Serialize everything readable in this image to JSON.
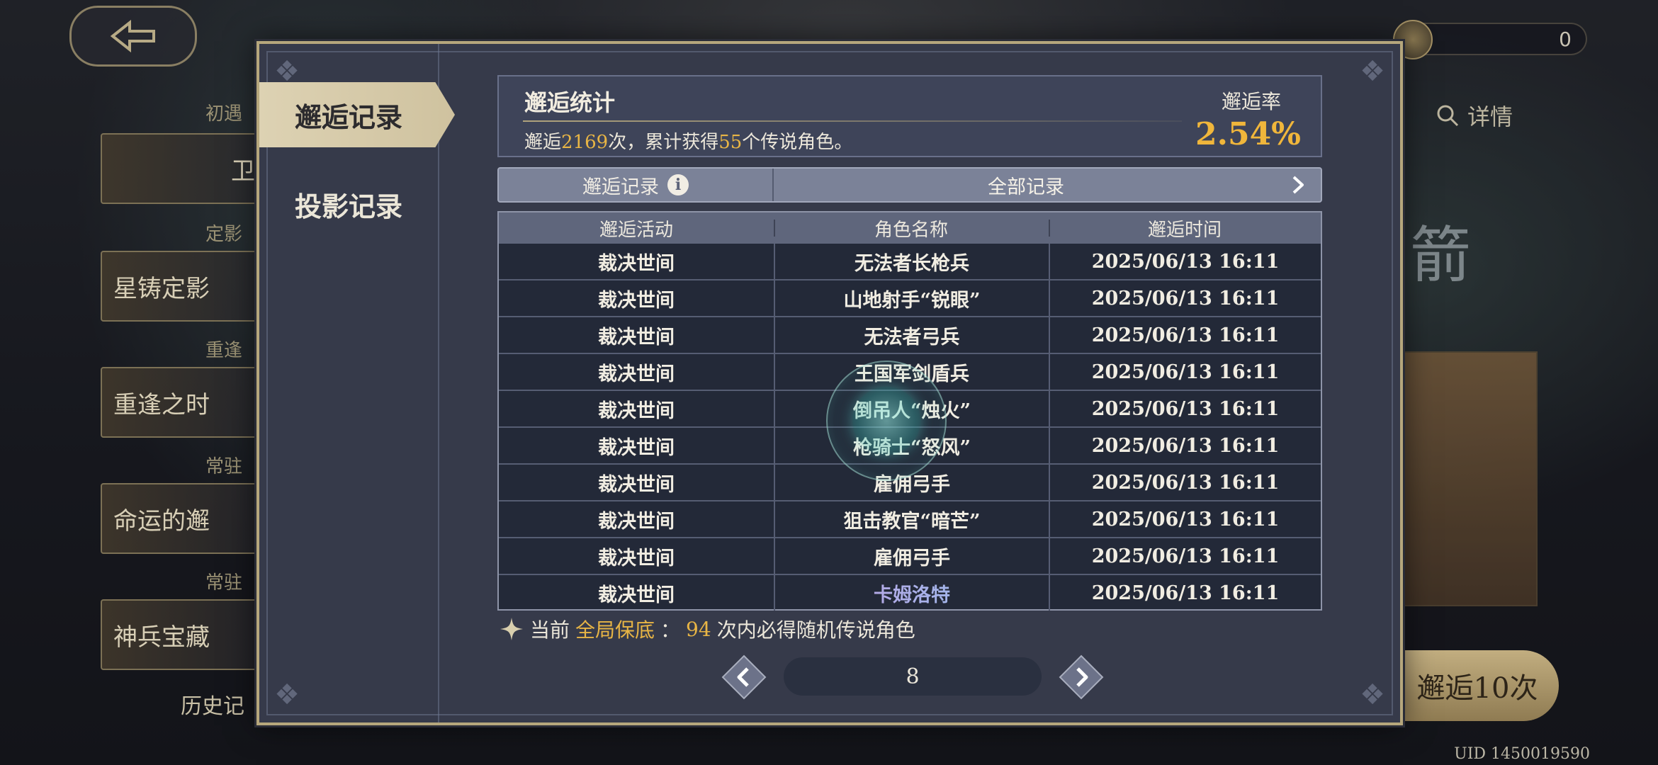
{
  "background": {
    "currency_amount": "0",
    "left_list": [
      {
        "tag": "初遇",
        "name": "卫"
      },
      {
        "tag": "定影",
        "name": "星铸定影"
      },
      {
        "tag": "重逢",
        "name": "重逢之时"
      },
      {
        "tag": "常驻",
        "name": "命运的邂"
      },
      {
        "tag": "常驻",
        "name": "神兵宝藏"
      }
    ],
    "history_label": "历史记",
    "details_label": "详情",
    "ten_pull_label": "邂逅10次",
    "uid": "UID 1450019590"
  },
  "tabs": [
    {
      "label": "邂逅记录",
      "active": true
    },
    {
      "label": "投影记录",
      "active": false
    }
  ],
  "summary": {
    "title": "邂逅统计",
    "text_prefix": "邂逅",
    "pull_count": "2169",
    "text_mid": "次，累计获得",
    "legend_count": "55",
    "text_suffix": "个传说角色。",
    "rate_label": "邂逅率",
    "rate_value": "2.54%"
  },
  "filter": {
    "label": "邂逅记录",
    "value": "全部记录"
  },
  "table": {
    "headers": [
      "邂逅活动",
      "角色名称",
      "邂逅时间"
    ],
    "rows": [
      {
        "event": "裁决世间",
        "name": "无法者长枪兵",
        "time": "2025/06/13 16:11",
        "legendary": false
      },
      {
        "event": "裁决世间",
        "name": "山地射手“锐眼”",
        "time": "2025/06/13 16:11",
        "legendary": false
      },
      {
        "event": "裁决世间",
        "name": "无法者弓兵",
        "time": "2025/06/13 16:11",
        "legendary": false
      },
      {
        "event": "裁决世间",
        "name": "王国军剑盾兵",
        "time": "2025/06/13 16:11",
        "legendary": false
      },
      {
        "event": "裁决世间",
        "name": "倒吊人“烛火”",
        "time": "2025/06/13 16:11",
        "legendary": false
      },
      {
        "event": "裁决世间",
        "name": "枪骑士“怒风”",
        "time": "2025/06/13 16:11",
        "legendary": false
      },
      {
        "event": "裁决世间",
        "name": "雇佣弓手",
        "time": "2025/06/13 16:11",
        "legendary": false
      },
      {
        "event": "裁决世间",
        "name": "狙击教官“暗芒”",
        "time": "2025/06/13 16:11",
        "legendary": false
      },
      {
        "event": "裁决世间",
        "name": "雇佣弓手",
        "time": "2025/06/13 16:11",
        "legendary": false
      },
      {
        "event": "裁决世间",
        "name": "卡姆洛特",
        "time": "2025/06/13 16:11",
        "legendary": true
      }
    ]
  },
  "pity": {
    "prefix": "当前",
    "highlight": "全局保底",
    "colon": "：",
    "count": "94",
    "suffix": "次内必得随机传说角色"
  },
  "pagination": {
    "page": "8"
  },
  "colors": {
    "accent_gold": "#e8b545",
    "modal_bg": "#363a4a",
    "border_gold": "#b6a77c",
    "legend_gradient": [
      "#c79ae0",
      "#8fc4f0"
    ]
  }
}
